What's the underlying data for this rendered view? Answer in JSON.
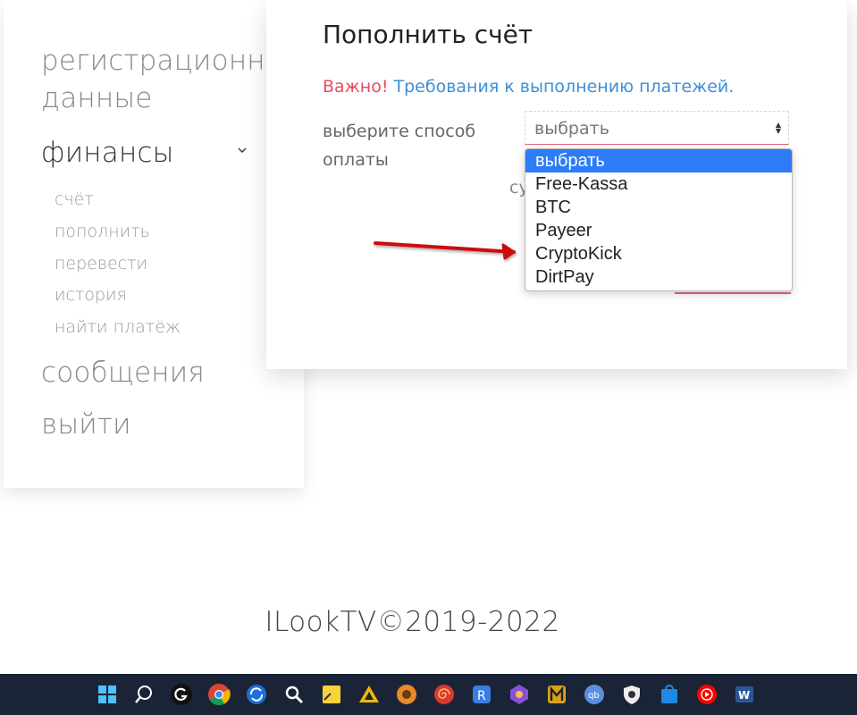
{
  "sidebar": {
    "registration": "регистрационные данные",
    "finance": "финансы",
    "finance_items": [
      "счёт",
      "пополнить",
      "перевести",
      "история",
      "найти платёж"
    ],
    "messages": "сообщения",
    "logout": "выйти"
  },
  "modal": {
    "title": "Пополнить счёт",
    "important": "Важно!",
    "requirements_link": "Требования к выполнению платежей.",
    "payment_label": "выберите способ оплаты",
    "select_value": "выбрать",
    "partial_label": "су",
    "options": [
      "выбрать",
      "Free-Kassa",
      "BTC",
      "Payeer",
      "CryptoKick",
      "DirtPay"
    ]
  },
  "footer": {
    "copyright": "ILookTV©2019-2022"
  },
  "colors": {
    "accent_red": "#e84a5f",
    "link_blue": "#3d8fd6",
    "select_highlight": "#2d7cf7",
    "taskbar": "#1b2436",
    "annotation_arrow": "#cc1111"
  },
  "taskbar": {
    "icons": [
      "windows-start-icon",
      "search-icon",
      "logitech-g-icon",
      "chrome-icon",
      "sync-icon",
      "magnifier-icon",
      "sticky-notes-icon",
      "app-yellow-triangle-icon",
      "app-orange-circle-icon",
      "app-red-spiral-icon",
      "app-blue-r-icon",
      "app-purple-hex-icon",
      "app-m-icon",
      "qbittorrent-icon",
      "shield-icon",
      "store-icon",
      "youtube-music-icon",
      "word-icon"
    ]
  }
}
